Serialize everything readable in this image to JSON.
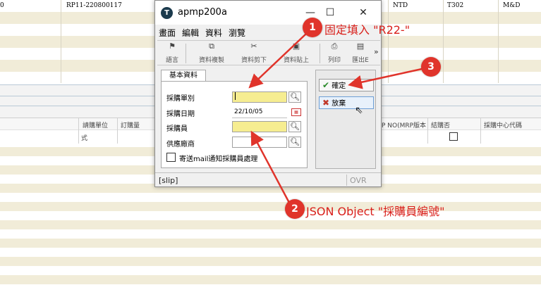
{
  "background": {
    "top_row": {
      "doc_no": "RP11-220800117",
      "currency": "NTD",
      "code": "T302",
      "dept": "M&D",
      "left_cut": "0"
    },
    "columns": {
      "request_unit": "請購單位",
      "order_qty": "訂購量",
      "no_mrp": "P NO(MRP版本",
      "closed": "結購否",
      "center_code": "採購中心代碼"
    },
    "row_value": "式"
  },
  "dialog": {
    "title": "apmp200a",
    "icon_letter": "T",
    "window_buttons": {
      "minimize": "—",
      "maximize": "☐",
      "close": "✕"
    },
    "menu": [
      "畫面",
      "編輯",
      "資料",
      "瀏覽"
    ],
    "toolbar": {
      "first": "語言",
      "copy": "資料複製",
      "cut": "資料剪下",
      "paste": "資料貼上",
      "print": "列印",
      "export": "匯出E",
      "more": "»"
    },
    "tab": "基本資料",
    "fields": {
      "doc_type_label": "採購單別",
      "date_label": "採購日期",
      "date_value": "22/10/05",
      "buyer_label": "採購員",
      "vendor_label": "供應廠商",
      "mail_label": "寄送mail通知採購員處理"
    },
    "buttons": {
      "ok": "確定",
      "cancel": "放棄"
    },
    "status": {
      "left": "[slip]",
      "right": "OVR"
    }
  },
  "annotations": [
    {
      "number": "1",
      "text": "固定填入 \"R22-\""
    },
    {
      "number": "2",
      "text": "JSON Object \"採購員編號\""
    },
    {
      "number": "3",
      "text": ""
    }
  ],
  "colors": {
    "annotation_red": "#e0342b",
    "required_field": "#f6ed91",
    "stripe": "#f1ecd8"
  }
}
